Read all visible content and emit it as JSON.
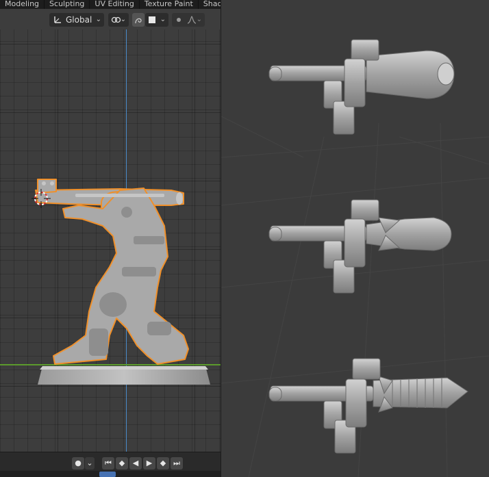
{
  "workspace_tabs": [
    "Modeling",
    "Sculpting",
    "UV Editing",
    "Texture Paint",
    "Shadi"
  ],
  "toolbar": {
    "orientation_label": "Global"
  },
  "colors": {
    "selection_outline": "#f0902a",
    "axis_blue": "#4a8ac9",
    "axis_green": "#5b9a2c",
    "frame_highlight": "#4772b3"
  },
  "icons": {
    "orientation": "orientation-axes-icon",
    "snapping": "snapping-icon",
    "proportional": "proportional-edit-icon",
    "shading": "shading-icon",
    "falloff": "falloff-curve-icon"
  },
  "timeline": {
    "buttons": [
      "●",
      "⏮",
      "◆",
      "◀",
      "▶",
      "◆",
      "⏭"
    ]
  }
}
